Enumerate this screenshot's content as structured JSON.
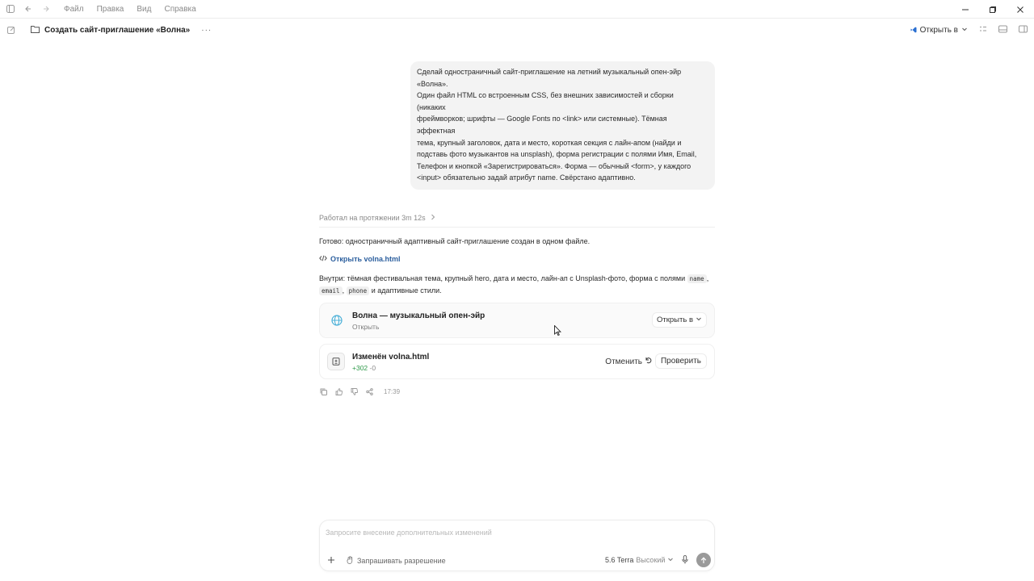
{
  "titlebar": {
    "menu": [
      "Файл",
      "Правка",
      "Вид",
      "Справка"
    ]
  },
  "header": {
    "title": "Создать сайт-приглашение «Волна»",
    "more": "···",
    "open_in_label": "Открыть в"
  },
  "user_message": {
    "lines": [
      "Сделай одностраничный сайт-приглашение на летний музыкальный опен-эйр",
      "«Волна».",
      "Один файл HTML со встроенным CSS, без внешних зависимостей и сборки",
      "(никаких",
      "фреймворков; шрифты — Google Fonts по <link> или системные). Тёмная",
      "эффектная",
      "тема, крупный заголовок, дата и место, короткая секция с лайн-апом (найди и",
      "подставь фото музыкантов на unsplash), форма регистрации с полями Имя, Email,",
      "Телефон и кнопкой «Зарегистрироваться». Форма — обычный <form>, у каждого",
      "<input> обязательно задай атрибут name. Свёрстано адаптивно."
    ]
  },
  "assistant": {
    "worked_label": "Работал на протяжении 3m 12s",
    "done_text": "Готово: одностраничный адаптивный сайт-приглашение создан в одном файле.",
    "open_link": "Открыть volna.html",
    "inside_prefix": "Внутри: тёмная фестивальная тема, крупный hero, дата и место, лайн-ап с Unsplash-фото, форма с полями",
    "code_name": "name",
    "code_email": "email",
    "code_phone": "phone",
    "inside_suffix": "и адаптивные стили.",
    "preview_card": {
      "title": "Волна — музыкальный опен-эйр",
      "subtitle": "Открыть",
      "open_in": "Открыть в"
    },
    "diff_card": {
      "title": "Изменён volna.html",
      "added": "+302",
      "removed": "-0",
      "undo_label": "Отменить",
      "review_label": "Проверить"
    },
    "time": "17:39"
  },
  "composer": {
    "placeholder": "Запросите внесение дополнительных изменений",
    "permission": "Запрашивать разрешение",
    "model": "5.6 Terra",
    "level": "Высокий"
  },
  "colors": {
    "link": "#2c5f9e",
    "added": "#2f9a4a",
    "globe": "#4ab0d8",
    "accent_vs": "#2a6fd1"
  }
}
